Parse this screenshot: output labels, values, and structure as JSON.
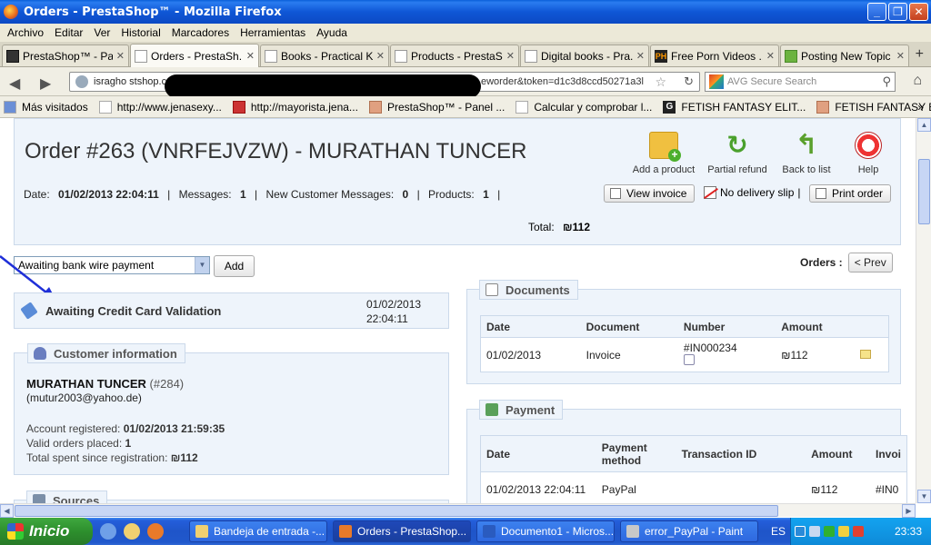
{
  "window": {
    "title": "Orders - PrestaShop™ - Mozilla Firefox"
  },
  "menu": [
    "Archivo",
    "Editar",
    "Ver",
    "Historial",
    "Marcadores",
    "Herramientas",
    "Ayuda"
  ],
  "tabs": [
    {
      "label": "PrestaShop™ - Pa..."
    },
    {
      "label": "Orders - PrestaSh..."
    },
    {
      "label": "Books - Practical K..."
    },
    {
      "label": "Products - PrestaS..."
    },
    {
      "label": "Digital books - Pra..."
    },
    {
      "label": "Free Porn Videos ..."
    },
    {
      "label": "Posting New Topic ..."
    }
  ],
  "nav": {
    "url_start": "isragho stshop.co",
    "url_end": "eworder&token=d1c3d8ccd50271a3l",
    "search_placeholder": "AVG Secure Search"
  },
  "bookmarks": [
    "Más visitados",
    "http://www.jenasexy...",
    "http://mayorista.jena...",
    "PrestaShop™ - Panel ...",
    "Calcular y comprobar l...",
    "FETISH FANTASY ELIT...",
    "FETISH FANTASY EXT..."
  ],
  "order": {
    "title": "Order #263 (VNRFEJVZW) - MURATHAN TUNCER",
    "date_label": "Date:",
    "date": "01/02/2013 22:04:11",
    "messages_label": "Messages:",
    "messages": "1",
    "new_messages_label": "New Customer Messages:",
    "new_messages": "0",
    "products_label": "Products:",
    "products": "1",
    "total_label": "Total:",
    "total": "₪112"
  },
  "toolbar": {
    "add_product": "Add a product",
    "partial_refund": "Partial refund",
    "back_to_list": "Back to list",
    "help": "Help",
    "view_invoice": "View invoice",
    "no_delivery": "No delivery slip",
    "print_order": "Print order"
  },
  "status": {
    "selected": "Awaiting bank wire payment",
    "add_label": "Add",
    "current": "Awaiting Credit Card Validation",
    "current_date": "01/02/2013",
    "current_time": "22:04:11"
  },
  "customer": {
    "legend": "Customer information",
    "name": "MURATHAN TUNCER",
    "id": "(#284)",
    "email": "(mutur2003@yahoo.de)",
    "registered_label": "Account registered:",
    "registered": "01/02/2013 21:59:35",
    "orders_label": "Valid orders placed:",
    "orders": "1",
    "spent_label": "Total spent since registration:",
    "spent": "₪112"
  },
  "sources": {
    "legend": "Sources"
  },
  "orders_nav": {
    "label": "Orders :",
    "prev": "< Prev"
  },
  "documents": {
    "legend": "Documents",
    "headers": [
      "Date",
      "Document",
      "Number",
      "Amount"
    ],
    "rows": [
      {
        "date": "01/02/2013",
        "document": "Invoice",
        "number": "#IN000234",
        "amount": "₪112"
      }
    ]
  },
  "payment": {
    "legend": "Payment",
    "headers": [
      "Date",
      "Payment method",
      "Transaction ID",
      "Amount",
      "Invoi"
    ],
    "rows": [
      {
        "date": "01/02/2013 22:04:11",
        "method": "PayPal",
        "transaction": "",
        "amount": "₪112",
        "invoice": "#IN0"
      }
    ]
  },
  "taskbar": {
    "start": "Inicio",
    "items": [
      "Bandeja de entrada -...",
      "Orders - PrestaShop...",
      "Documento1 - Micros...",
      "error_PayPal - Paint"
    ],
    "lang": "ES",
    "clock": "23:33"
  },
  "colors": {
    "panel_bg": "#eef4fb",
    "panel_border": "#cbd9ea",
    "xp_blue": "#245edb",
    "start_green": "#2d8f2d"
  }
}
